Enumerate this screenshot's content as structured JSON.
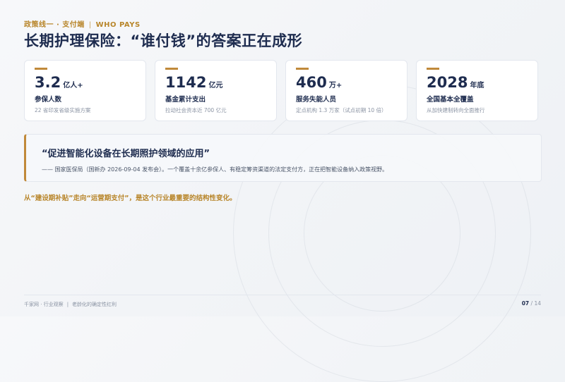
{
  "header": {
    "kicker_left": "政策线一 · 支付端",
    "kicker_sep": "|",
    "kicker_right": "WHO PAYS",
    "title": "长期护理保险：“谁付钱”的答案正在成形"
  },
  "stats": [
    {
      "value": "3.2",
      "unit": "亿人+",
      "label": "参保人数",
      "sub": "22 省印发省级实施方案"
    },
    {
      "value": "1142",
      "unit": "亿元",
      "label": "基金累计支出",
      "sub": "拉动社会资本近 700 亿元"
    },
    {
      "value": "460",
      "unit": "万+",
      "label": "服务失能人员",
      "sub": "定点机构 1.3 万家（试点初期 10 倍）"
    },
    {
      "value": "2028",
      "unit": "年底",
      "label": "全国基本全覆盖",
      "sub": "从加快建制转向全面推行"
    }
  ],
  "quote": {
    "text": "“促进智能化设备在长期照护领域的应用”",
    "source": "—— 国家医保局（国新办 2026-09-04 发布会）。一个覆盖十余亿参保人、有稳定筹资渠道的法定支付方，正在把智能设备纳入政策视野。"
  },
  "takeaway": "从“建设期补贴”走向“运营期支付”，是这个行业最重要的结构性变化。",
  "footer": {
    "source": "千家网 · 行业观察",
    "sep": "|",
    "topic": "老龄化的确定性红利",
    "page_current": "07",
    "page_sep": "/",
    "page_total": "14"
  },
  "colors": {
    "accent": "#c0893a",
    "navy": "#1e2c4f"
  }
}
